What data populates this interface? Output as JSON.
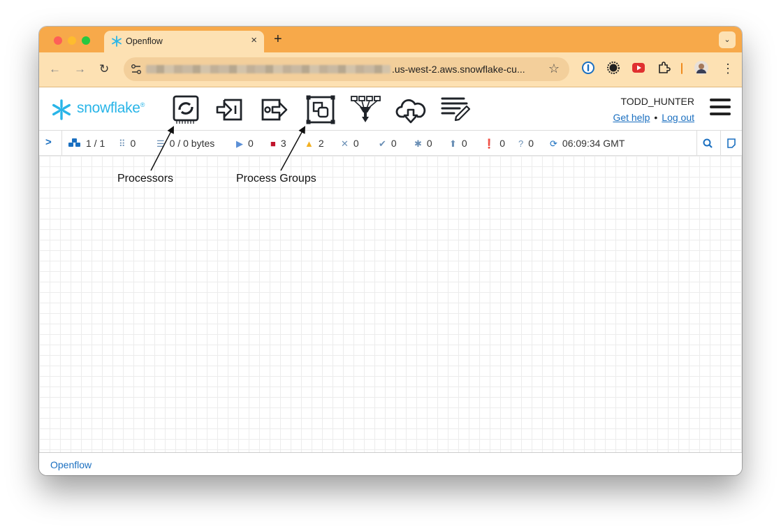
{
  "browser": {
    "tab_title": "Openflow",
    "tab_close": "×",
    "new_tab": "+",
    "url_visible": ".us-west-2.aws.snowflake-cu...",
    "star": "☆",
    "menu": "⋮",
    "tab_search": "⌄"
  },
  "header": {
    "logo_text": "snowflake",
    "logo_reg": "®",
    "username": "TODD_HUNTER",
    "get_help": "Get help",
    "separator": "•",
    "log_out": "Log out"
  },
  "toolbar_icons": [
    "processor-icon",
    "input-port-icon",
    "output-port-icon",
    "process-group-icon",
    "remote-process-group-icon",
    "funnel-icon",
    "template-icon",
    "label-icon"
  ],
  "status": {
    "groups": "1 / 1",
    "transmitting": "0",
    "queued": "0 / 0 bytes",
    "running": "0",
    "stopped": "3",
    "invalid": "2",
    "disabled": "0",
    "up_to_date": "0",
    "locally_modified": "0",
    "stale": "0",
    "errors": "0",
    "sync_failure": "0",
    "last_refreshed": "06:09:34 GMT"
  },
  "annotations": {
    "processors": "Processors",
    "process_groups": "Process Groups"
  },
  "footer": {
    "breadcrumb": "Openflow"
  },
  "colors": {
    "tabstrip": "#f7a94a",
    "toolbar": "#fde1b3",
    "brand": "#29b5e8",
    "link": "#1a6fc0",
    "stopped": "#c0142c",
    "warning": "#f2b022"
  }
}
